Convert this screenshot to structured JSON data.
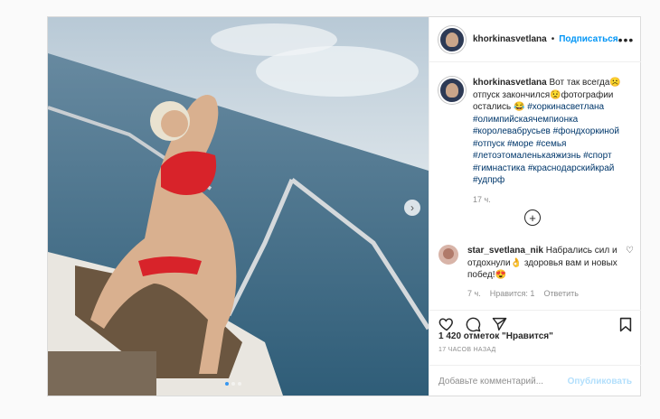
{
  "post": {
    "username": "khorkinasvetlana",
    "separator": "•",
    "follow_label": "Подписаться",
    "more_label": "•••",
    "caption_text": "Вот так всегда☹️ отпуск закончился😟фотографии остались 😂",
    "hashtags": "#хоркинасветлана #олимпийскаячемпионка #королевабрусьев #фондхоркиной #отпуск #море #семья #летоэтомаленькаяжизнь #спорт #гимнастика #краснодарскийкрай #удпрф",
    "caption_time": "17 ч.",
    "comment": {
      "username": "star_svetlana_nik",
      "text": "Набрались сил и отдохнули👌 здоровья вам и новых побед!😍",
      "time": "7 ч.",
      "likes_label": "Нравится: 1",
      "reply_label": "Ответить"
    },
    "likes": "1 420 отметок \"Нравится\"",
    "ago": "17 ЧАСОВ НАЗАД",
    "add_comment_placeholder": "Добавьте комментарий...",
    "publish_label": "Опубликовать"
  },
  "icons": {
    "next": "chevron-right-icon",
    "heart": "heart-icon",
    "comment": "comment-icon",
    "share": "share-icon",
    "bookmark": "bookmark-icon",
    "plus": "plus-circle-icon"
  },
  "colors": {
    "link": "#0095f6",
    "hashtag": "#00376b",
    "muted": "#8e8e8e"
  },
  "carousel": {
    "total": 3,
    "active": 1
  }
}
